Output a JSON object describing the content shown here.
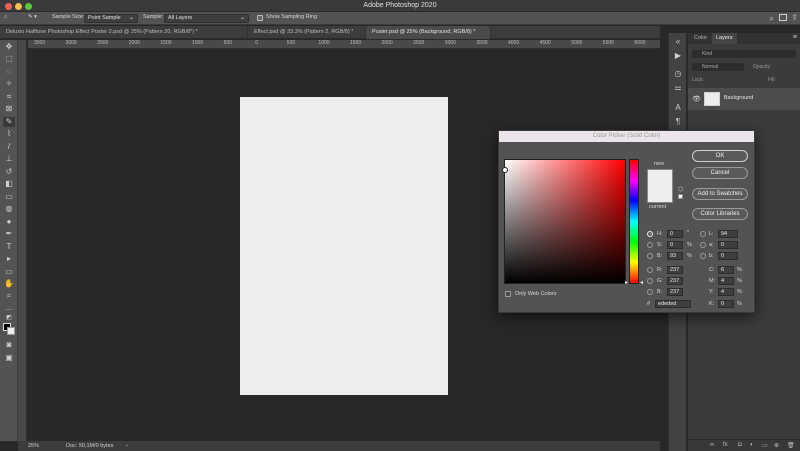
{
  "app": {
    "title": "Adobe Photoshop 2020"
  },
  "options_bar": {
    "sample_size_label": "Sample Size:",
    "sample_size_value": "Point Sample",
    "sample_label": "Sample:",
    "sample_value": "All Layers",
    "show_ring_label": "Show Sampling Ring"
  },
  "tabs": [
    {
      "label": "Deluxio Halftone Photoshop Effect Poster 2.psd @ 25% (Pattern 20, RGB/8*) *"
    },
    {
      "label": "Effect.psd @ 33.3% (Pattern 2, RGB/8) *"
    },
    {
      "label": "Poster.psd @ 25% (Background, RGB/8) *"
    }
  ],
  "ruler": {
    "ticks": [
      "3500",
      "3000",
      "2500",
      "2000",
      "1500",
      "1000",
      "500",
      "0",
      "500",
      "1000",
      "1500",
      "2000",
      "2500",
      "3000",
      "3500",
      "4000",
      "4500",
      "5000",
      "5500",
      "6000"
    ]
  },
  "status": {
    "zoom": "25%",
    "doc": "Doc: 50,1M/0 bytes"
  },
  "panel": {
    "tabs": [
      "Color",
      "Layers"
    ],
    "search": "Kind",
    "blend_mode": "Normal",
    "opacity_label": "Opacity:",
    "lock_label": "Lock:",
    "fill_label": "Fill:",
    "layer_name": "Background"
  },
  "picker": {
    "title": "Color Picker (Solid Color)",
    "new_label": "new",
    "current_label": "current",
    "ok": "OK",
    "cancel": "Cancel",
    "add_swatches": "Add to Swatches",
    "color_libraries": "Color Libraries",
    "only_web": "Only Web Colors",
    "H": "0",
    "H_unit": "°",
    "S": "0",
    "S_unit": "%",
    "B": "93",
    "B_unit": "%",
    "R": "237",
    "G": "237",
    "Bv": "237",
    "L": "94",
    "a": "0",
    "b": "0",
    "C": "6",
    "M": "4",
    "Y": "4",
    "K": "0",
    "hex_label": "#",
    "hex": "ededed",
    "current_color": "#ededed"
  }
}
